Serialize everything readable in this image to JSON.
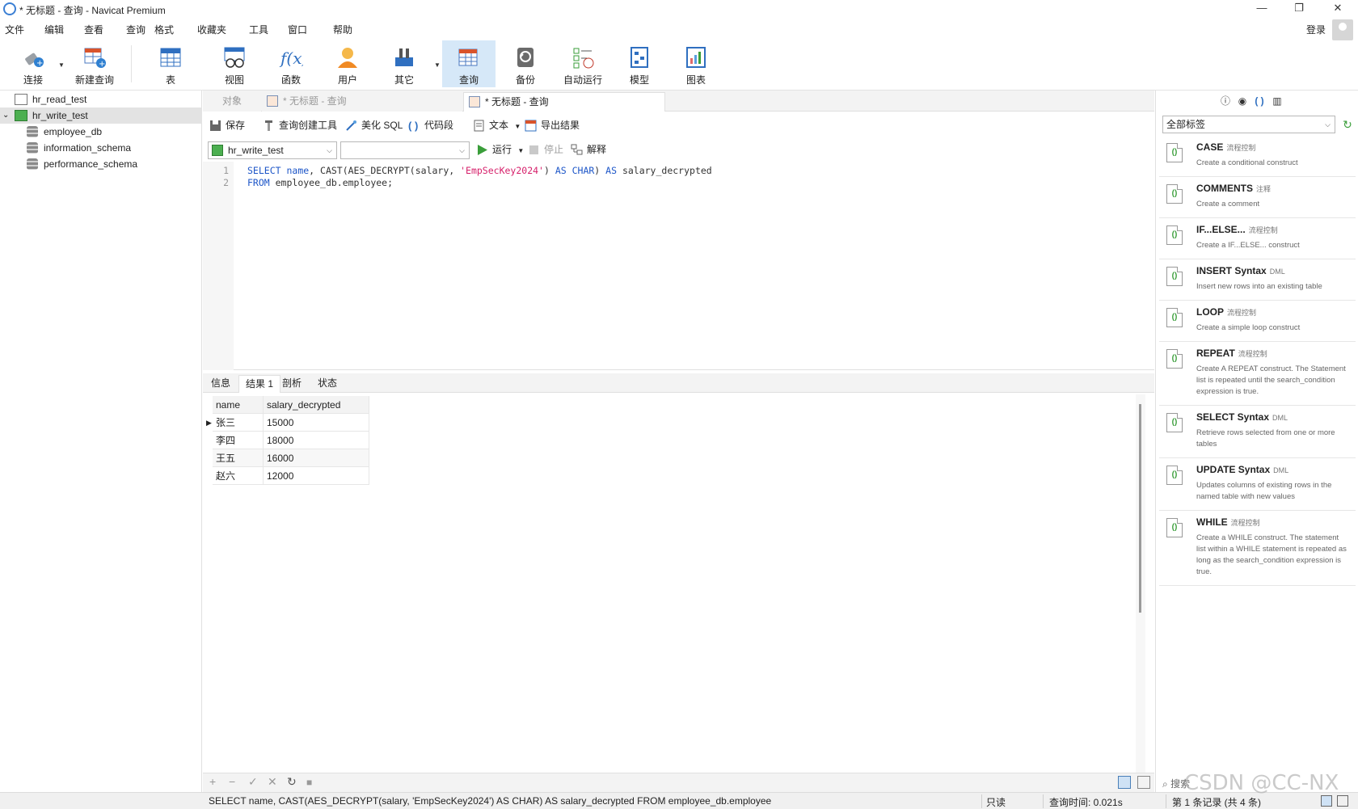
{
  "window": {
    "title": "* 无标题 - 查询 - Navicat Premium",
    "minimize": "—",
    "maximize": "❐",
    "close": "✕"
  },
  "menubar": {
    "items": [
      "文件",
      "编辑",
      "查看",
      "查询",
      "格式",
      "收藏夹",
      "工具",
      "窗口",
      "帮助"
    ],
    "login": "登录"
  },
  "toolbar": {
    "buttons": [
      {
        "label": "连接",
        "icon": "plug-icon"
      },
      {
        "label": "新建查询",
        "icon": "new-query-icon"
      },
      {
        "label": "表",
        "icon": "table-icon"
      },
      {
        "label": "视图",
        "icon": "view-icon"
      },
      {
        "label": "函数",
        "icon": "function-icon"
      },
      {
        "label": "用户",
        "icon": "user-icon"
      },
      {
        "label": "其它",
        "icon": "tools-icon"
      },
      {
        "label": "查询",
        "icon": "query-icon"
      },
      {
        "label": "备份",
        "icon": "backup-icon"
      },
      {
        "label": "自动运行",
        "icon": "automation-icon"
      },
      {
        "label": "模型",
        "icon": "model-icon"
      },
      {
        "label": "图表",
        "icon": "chart-icon"
      }
    ],
    "active": "查询"
  },
  "sidebar": {
    "connections": [
      {
        "name": "hr_read_test",
        "expanded": false
      },
      {
        "name": "hr_write_test",
        "expanded": true,
        "databases": [
          "employee_db",
          "information_schema",
          "performance_schema"
        ]
      }
    ]
  },
  "tabs": [
    {
      "label": "对象",
      "state": "inactive"
    },
    {
      "label": "* 无标题 - 查询",
      "state": "inactive"
    },
    {
      "label": "* 无标题 - 查询",
      "state": "active"
    }
  ],
  "query_toolbar": {
    "save": "保存",
    "builder": "查询创建工具",
    "beautify": "美化 SQL",
    "snippet": "代码段",
    "text": "文本",
    "export": "导出结果"
  },
  "run_bar": {
    "connection": "hr_write_test",
    "database": "",
    "run": "运行",
    "stop": "停止",
    "explain": "解释"
  },
  "editor": {
    "line_numbers": [
      "1",
      "2"
    ],
    "line1": {
      "t1": "SELECT",
      "t2": " name",
      "t3": ", CAST(AES_DECRYPT(salary, ",
      "t4": "'EmpSecKey2024'",
      "t5": ") ",
      "t6": "AS CHAR",
      "t7": ") ",
      "t8": "AS",
      "t9": " salary_decrypted"
    },
    "line2": {
      "t1": "FROM",
      "t2": " employee_db.employee;"
    }
  },
  "result_tabs": [
    "信息",
    "结果 1",
    "剖析",
    "状态"
  ],
  "result_grid": {
    "columns": [
      "name",
      "salary_decrypted"
    ],
    "rows": [
      [
        "张三",
        "15000"
      ],
      [
        "李四",
        "18000"
      ],
      [
        "王五",
        "16000"
      ],
      [
        "赵六",
        "12000"
      ]
    ]
  },
  "grid_footer": {
    "add": "+",
    "remove": "−",
    "apply": "✓",
    "discard": "✕",
    "refresh": "↻",
    "stop": "■"
  },
  "right_panel": {
    "tag_filter": "全部标签",
    "snippets": [
      {
        "title": "CASE",
        "tag": "流程控制",
        "desc": "Create a conditional construct"
      },
      {
        "title": "COMMENTS",
        "tag": "注释",
        "desc": "Create a comment"
      },
      {
        "title": "IF...ELSE...",
        "tag": "流程控制",
        "desc": "Create a IF...ELSE... construct"
      },
      {
        "title": "INSERT Syntax",
        "tag": "DML",
        "desc": "Insert new rows into an existing table"
      },
      {
        "title": "LOOP",
        "tag": "流程控制",
        "desc": "Create a simple loop construct"
      },
      {
        "title": "REPEAT",
        "tag": "流程控制",
        "desc": "Create A REPEAT construct. The Statement list is repeated until the search_condition expression is true."
      },
      {
        "title": "SELECT Syntax",
        "tag": "DML",
        "desc": "Retrieve rows selected from one or more tables"
      },
      {
        "title": "UPDATE Syntax",
        "tag": "DML",
        "desc": "Updates columns of existing rows in the named table with new values"
      },
      {
        "title": "WHILE",
        "tag": "流程控制",
        "desc": "Create a WHILE construct. The statement list within a WHILE statement is repeated as long as the search_condition expression is true."
      }
    ],
    "search_placeholder": "搜索"
  },
  "status_bar": {
    "sql": "SELECT name, CAST(AES_DECRYPT(salary, 'EmpSecKey2024') AS CHAR) AS salary_decrypted FROM employee_db.employee",
    "mode": "只读",
    "query_time": "查询时间: 0.021s",
    "record": "第 1 条记录 (共 4 条)"
  },
  "watermark": "CSDN @CC-NX",
  "colors": {
    "keyword": "#1d56c8",
    "string": "#d61f6a",
    "active_toolbar": "#d6e8f8",
    "selected_tree": "#e3e3e3"
  }
}
